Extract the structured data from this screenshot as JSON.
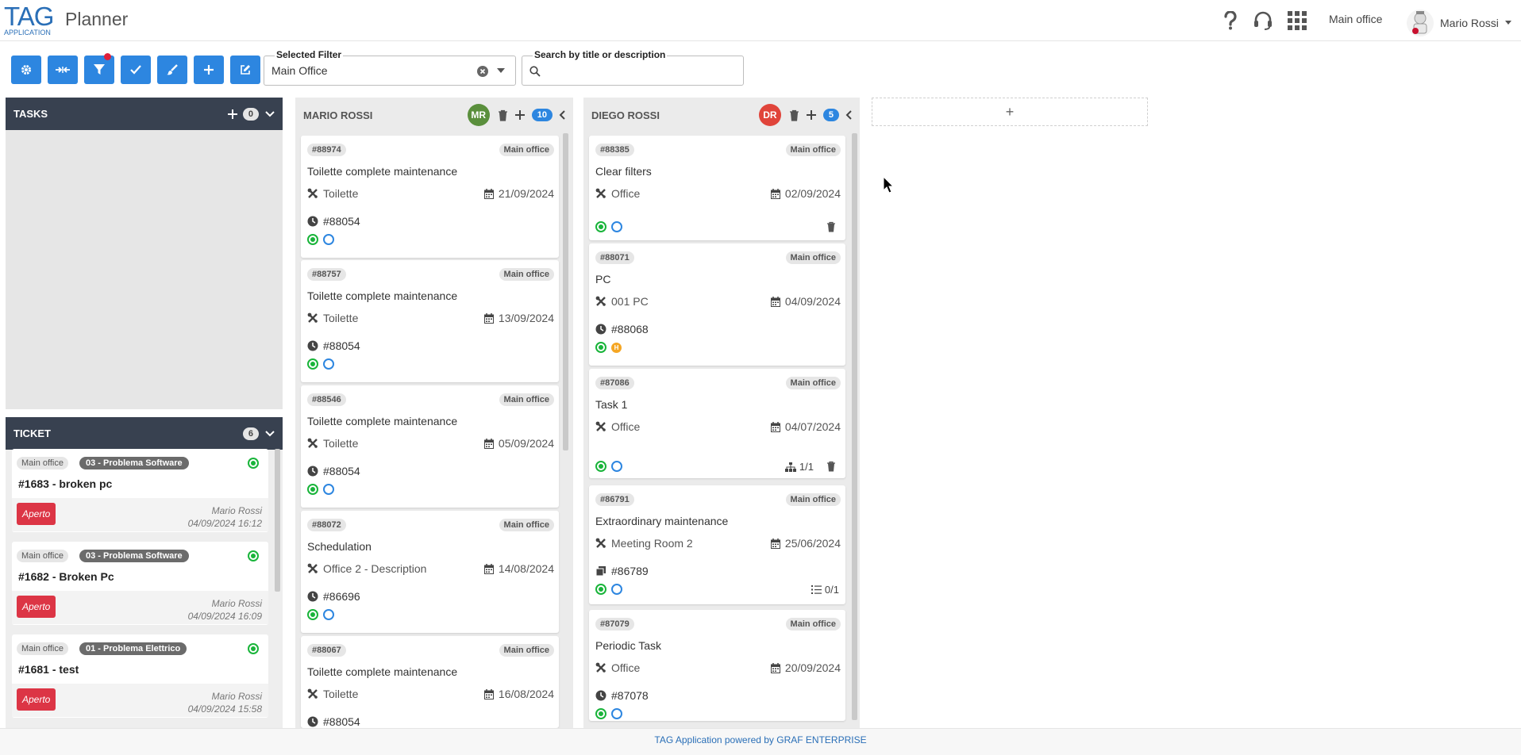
{
  "header": {
    "logo_text": "TAG",
    "logo_sub": "APPLICATION",
    "title": "Planner",
    "office": "Main office",
    "user": "Mario Rossi"
  },
  "toolbar": {
    "buttons": [
      "settings-icon",
      "collapse-icon",
      "filter-icon",
      "check-icon",
      "brush-icon",
      "plus-icon",
      "edit-icon"
    ],
    "selected_filter_label": "Selected Filter",
    "selected_filter_value": "Main Office",
    "search_label": "Search by title or description",
    "search_value": ""
  },
  "tasks": {
    "title": "TASKS",
    "count": "0"
  },
  "ticket": {
    "title": "TICKET",
    "count": "6",
    "items": [
      {
        "office": "Main office",
        "category": "03 - Problema Software",
        "title": "#1683 - broken pc",
        "status": "Aperto",
        "user": "Mario Rossi",
        "date": "04/09/2024 16:12"
      },
      {
        "office": "Main office",
        "category": "03 - Problema Software",
        "title": "#1682 - Broken Pc",
        "status": "Aperto",
        "user": "Mario Rossi",
        "date": "04/09/2024 16:09"
      },
      {
        "office": "Main office",
        "category": "01 - Problema Elettrico",
        "title": "#1681 - test",
        "status": "Aperto",
        "user": "Mario Rossi",
        "date": "04/09/2024 15:58"
      }
    ]
  },
  "columns": [
    {
      "name": "MARIO ROSSI",
      "initials": "MR",
      "avatar_color": "#5a8f3c",
      "count": "10",
      "cards": [
        {
          "id": "#88974",
          "office": "Main office",
          "title": "Toilette complete maintenance",
          "location": "Toilette",
          "date": "21/09/2024",
          "ref": "#88054"
        },
        {
          "id": "#88757",
          "office": "Main office",
          "title": "Toilette complete maintenance",
          "location": "Toilette",
          "date": "13/09/2024",
          "ref": "#88054"
        },
        {
          "id": "#88546",
          "office": "Main office",
          "title": "Toilette complete maintenance",
          "location": "Toilette",
          "date": "05/09/2024",
          "ref": "#88054"
        },
        {
          "id": "#88072",
          "office": "Main office",
          "title": "Schedulation",
          "location": "Office 2 - Description",
          "date": "14/08/2024",
          "ref": "#86696"
        },
        {
          "id": "#88067",
          "office": "Main office",
          "title": "Toilette complete maintenance",
          "location": "Toilette",
          "date": "16/08/2024",
          "ref": "#88054"
        }
      ]
    },
    {
      "name": "DIEGO ROSSI",
      "initials": "DR",
      "avatar_color": "#e0443a",
      "count": "5",
      "cards": [
        {
          "id": "#88385",
          "office": "Main office",
          "title": "Clear filters",
          "location": "Office",
          "date": "02/09/2024",
          "ref": ""
        },
        {
          "id": "#88071",
          "office": "Main office",
          "title": "PC",
          "location": "001 PC",
          "date": "04/09/2024",
          "ref": "#88068"
        },
        {
          "id": "#87086",
          "office": "Main office",
          "title": "Task 1",
          "location": "Office",
          "date": "04/07/2024",
          "ref": "",
          "subtasks": "1/1"
        },
        {
          "id": "#86791",
          "office": "Main office",
          "title": "Extraordinary maintenance",
          "location": "Meeting Room 2",
          "date": "25/06/2024",
          "ref": "#86789",
          "checklist": "0/1"
        },
        {
          "id": "#87079",
          "office": "Main office",
          "title": "Periodic Task",
          "location": "Office",
          "date": "20/09/2024",
          "ref": "#87078"
        }
      ]
    }
  ],
  "add_column_label": "+",
  "footer": "TAG Application powered by GRAF ENTERPRISE",
  "colors": {
    "primary": "#2d86e0",
    "dark": "#384150",
    "danger": "#dc3545",
    "green": "#19b43a"
  }
}
